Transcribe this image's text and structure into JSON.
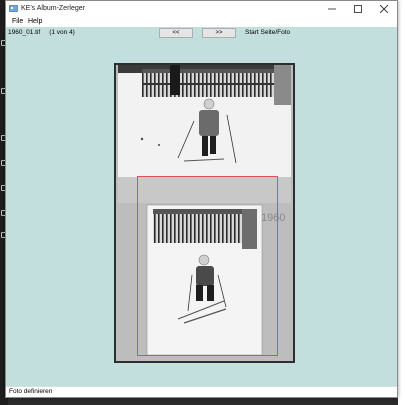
{
  "window": {
    "title": "KE's Album-Zerleger",
    "icon": "app-photo-icon"
  },
  "menu": {
    "items": [
      "File",
      "Help"
    ]
  },
  "toolbar": {
    "file_info": "1960_01.tif     (1 von 4)",
    "prev_label": "<<",
    "next_label": ">>",
    "start_label": "Start Seite/Foto"
  },
  "photo": {
    "annotation": "1960"
  },
  "status": {
    "text": "Foto definieren"
  },
  "colors": {
    "client_bg": "#c3dfdd",
    "selection": "#e05050"
  }
}
